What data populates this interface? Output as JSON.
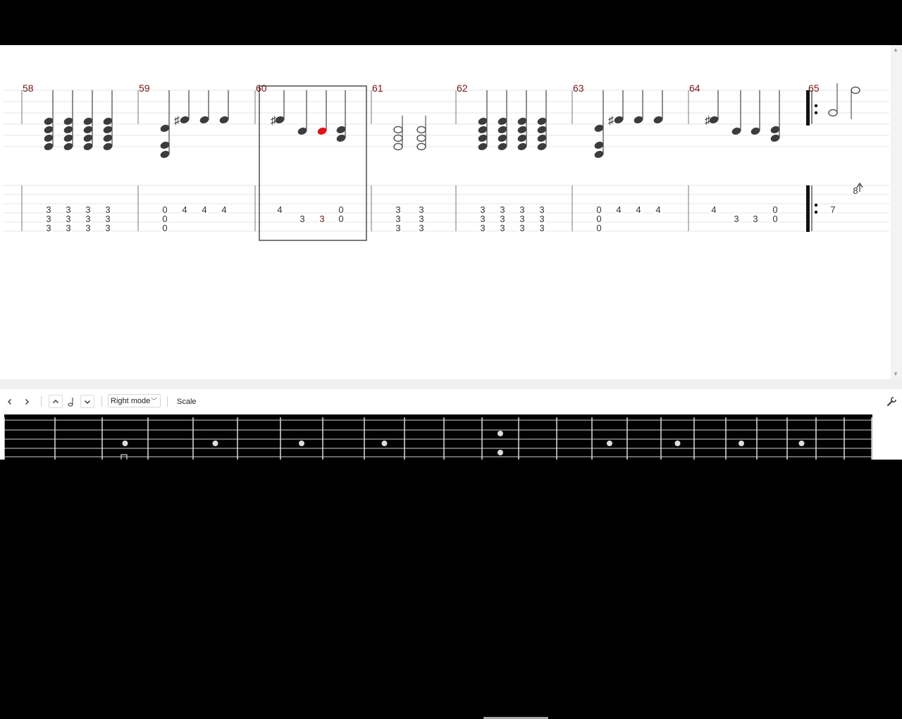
{
  "score": {
    "measures": [
      {
        "number": "58",
        "tab": [
          [
            "3",
            "3",
            "3"
          ],
          [
            "3",
            "3",
            "3"
          ],
          [
            "3",
            "3",
            "3"
          ],
          [
            "3",
            "3",
            "3"
          ]
        ]
      },
      {
        "number": "59",
        "tab": [
          [
            "0",
            "0",
            "0"
          ],
          [
            "4"
          ],
          [
            "4"
          ],
          [
            "4"
          ]
        ]
      },
      {
        "number": "60",
        "tab": [
          [
            "4"
          ],
          [
            "3"
          ],
          [
            "3"
          ],
          [
            "0",
            "0"
          ]
        ],
        "selected": true,
        "selected_note_index": 2
      },
      {
        "number": "61",
        "tab": [
          [
            "3",
            "3",
            "3"
          ],
          [
            "3",
            "3",
            "3"
          ]
        ]
      },
      {
        "number": "62",
        "tab": [
          [
            "3",
            "3",
            "3"
          ],
          [
            "3",
            "3",
            "3"
          ],
          [
            "3",
            "3",
            "3"
          ],
          [
            "3",
            "3",
            "3"
          ]
        ]
      },
      {
        "number": "63",
        "tab": [
          [
            "0",
            "0",
            "0"
          ],
          [
            "4"
          ],
          [
            "4"
          ],
          [
            "4"
          ]
        ]
      },
      {
        "number": "64",
        "tab": [
          [
            "4"
          ],
          [
            "3"
          ],
          [
            "3"
          ],
          [
            "0",
            "0"
          ]
        ]
      },
      {
        "number": "65",
        "tab": [
          [
            "7"
          ],
          [
            "8"
          ]
        ],
        "repeat_start": true
      }
    ],
    "colors": {
      "measure_number": "#7a1414",
      "selected_note": "#e01414",
      "note": "#3c3c3c"
    }
  },
  "toolbar": {
    "prev_icon": "chevron-left-icon",
    "next_icon": "chevron-right-icon",
    "up_icon": "chevron-up-icon",
    "note_icon": "note-icon",
    "down_icon": "chevron-down-icon",
    "mode_value": "Right mode",
    "scale_label": "Scale",
    "settings_icon": "wrench-icon"
  },
  "fretboard": {
    "strings": 4,
    "fret_markers": [
      3,
      5,
      7,
      9,
      12,
      15,
      17,
      19,
      21
    ],
    "double_marker": 12
  }
}
